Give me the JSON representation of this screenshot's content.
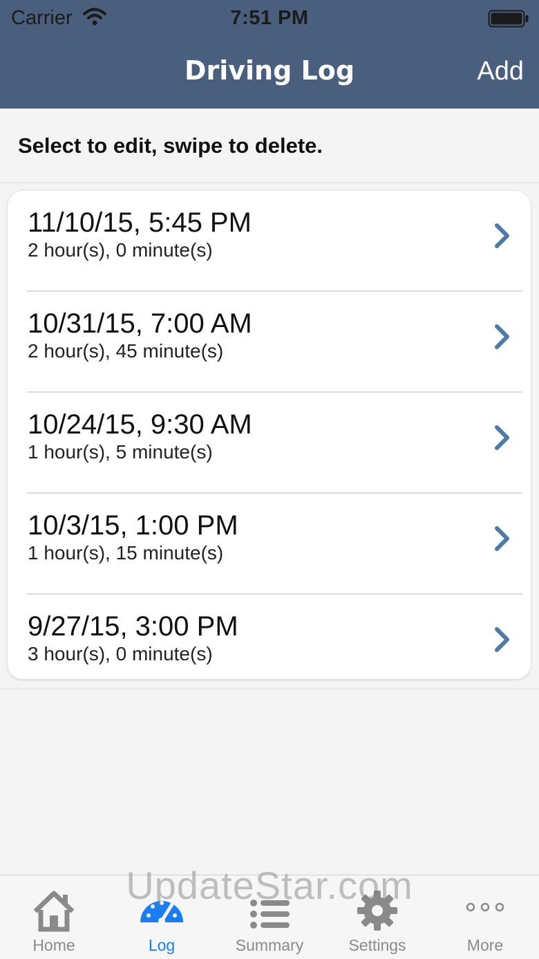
{
  "status_bar": {
    "carrier": "Carrier",
    "time": "7:51 PM"
  },
  "nav": {
    "title": "Driving Log",
    "add_label": "Add"
  },
  "instructions": "Select to edit, swipe to delete.",
  "log_entries": [
    {
      "date": "11/10/15, 5:45 PM",
      "duration": "2 hour(s), 0 minute(s)"
    },
    {
      "date": "10/31/15, 7:00 AM",
      "duration": "2 hour(s), 45 minute(s)"
    },
    {
      "date": "10/24/15, 9:30 AM",
      "duration": "1 hour(s), 5 minute(s)"
    },
    {
      "date": "10/3/15, 1:00 PM",
      "duration": "1 hour(s), 15 minute(s)"
    },
    {
      "date": "9/27/15, 3:00 PM",
      "duration": "3 hour(s), 0 minute(s)"
    }
  ],
  "tabs": [
    {
      "label": "Home",
      "icon": "home-icon"
    },
    {
      "label": "Log",
      "icon": "speedometer-icon",
      "active": true
    },
    {
      "label": "Summary",
      "icon": "list-icon"
    },
    {
      "label": "Settings",
      "icon": "gear-icon"
    },
    {
      "label": "More",
      "icon": "more-dots-icon"
    }
  ],
  "watermark": "UpdateStar.com",
  "colors": {
    "nav_bar": "#4a5f7e",
    "chevron": "#4e7aa6",
    "active_tab": "#1a7ef2",
    "inactive_tab": "#8a8a8a"
  }
}
